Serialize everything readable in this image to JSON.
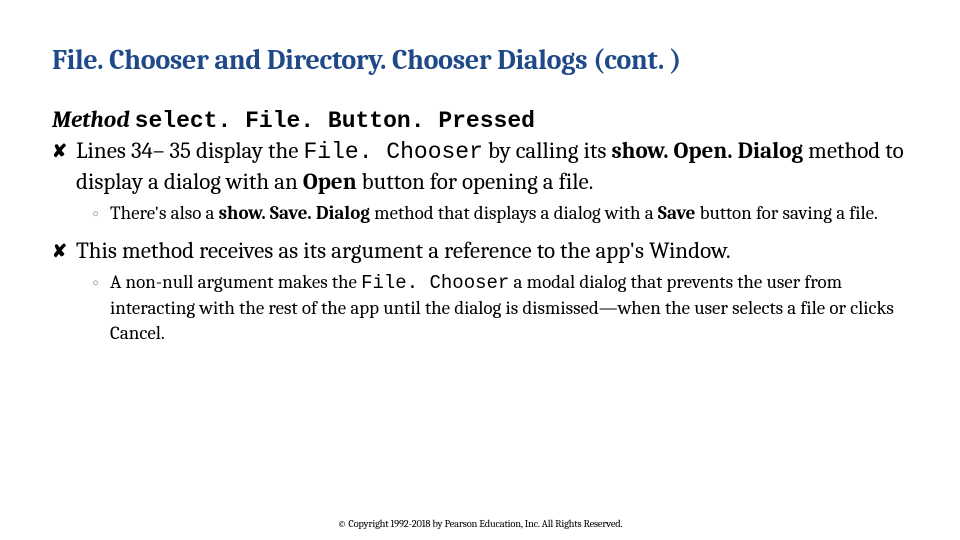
{
  "title": "File. Chooser and Directory. Chooser Dialogs (cont. )",
  "subhead_label": "Method ",
  "subhead_code": "select. File. Button. Pressed",
  "b1_pre": "Lines 34– 35 display the ",
  "b1_code1": "File. Chooser",
  "b1_mid": " by calling its ",
  "b1_bold1": "show. Open. Dialog",
  "b1_post1": " method to display a dialog with an ",
  "b1_bold2": "Open",
  "b1_post2": " button for opening a file.",
  "s1_pre": "There's also a ",
  "s1_bold1": "show. Save. Dialog",
  "s1_mid": " method that displays a dialog with a ",
  "s1_bold2": "Save",
  "s1_post": " button for saving a file.",
  "b2_text": "This method receives as its argument a reference to the app's Window.",
  "s2_pre": "A non-null argument makes the ",
  "s2_code": "File. Chooser",
  "s2_post": " a modal dialog that prevents the user from interacting with the rest of the app until the dialog is dismissed—when the user selects a file or clicks Cancel.",
  "footer": "© Copyright 1992-2018 by Pearson Education, Inc. All Rights Reserved."
}
